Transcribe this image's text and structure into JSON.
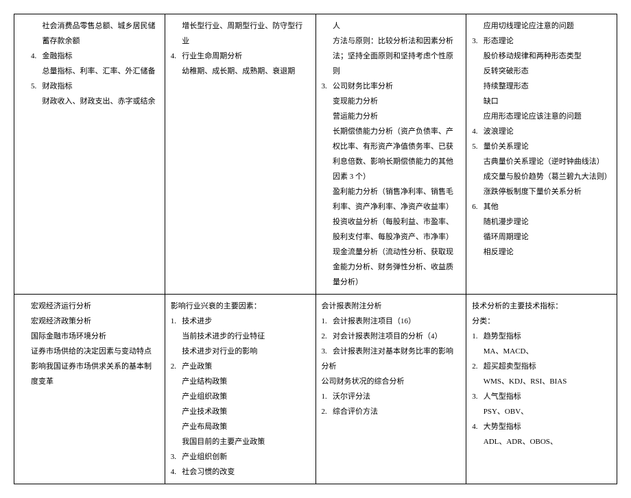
{
  "row1": {
    "c1": {
      "l1": "社会消费品零售总额、城乡居民储蓄存款余额",
      "n4": "4.",
      "t4": "金融指标",
      "t4a": "总量指标、利率、汇率、外汇储备",
      "n5": "5.",
      "t5": "财政指标",
      "t5a": "财政收入、财政支出、赤字或结余"
    },
    "c2": {
      "l1": "增长型行业、周期型行业、防守型行业",
      "n4": "4.",
      "t4": "行业生命周期分析",
      "t4a": "幼稚期、成长期、成熟期、衰退期"
    },
    "c3": {
      "l0": "人",
      "l1": "方法与原则：比较分析法和因素分析法；坚持全面原则和坚持考虑个性原则",
      "n3": "3.",
      "t3": "公司财务比率分析",
      "l3a": "变现能力分析",
      "l3b": "营运能力分析",
      "l3c": "长期偿债能力分析（资产负债率、产权比率、有形资产净值债务率、已获利息倍数、影响长期偿债能力的其他因素 3 个）",
      "l3d": "盈利能力分析（销售净利率、销售毛利率、资产净利率、净资产收益率）",
      "l3e": "投资收益分析（每股利益、市盈率、股利支付率、每股净资产、市净率）",
      "l3f": "现金流量分析（流动性分析、获取现金能力分析、财务弹性分析、收益质量分析）"
    },
    "c4": {
      "l1": "应用切线理论应注意的问题",
      "n3": "3.",
      "t3": "形态理论",
      "l3a": "股价移动规律和两种形态类型",
      "l3b": "反转突破形态",
      "l3c": "持续整理形态",
      "l3d": "缺口",
      "l3e": "应用形态理论应该注意的问题",
      "n4": "4.",
      "t4": "波浪理论",
      "n5": "5.",
      "t5": "量价关系理论",
      "l5a": "古典量价关系理论（逆时钟曲线法）",
      "l5b": "成交量与股价趋势（葛兰碧九大法则）",
      "l5c": "涨跌停板制度下量价关系分析",
      "n6": "6.",
      "t6": "其他",
      "l6a": "随机漫步理论",
      "l6b": "循环周期理论",
      "l6c": "相反理论"
    }
  },
  "row2": {
    "c1": {
      "l1": "宏观经济运行分析",
      "l2": "宏观经济政策分析",
      "l3": "国际金融市场环境分析",
      "l4": "证券市场供给的决定因素与变动特点",
      "l5": "影响我国证券市场供求关系的基本制度变革"
    },
    "c2": {
      "h": "影响行业兴衰的主要因素：",
      "n1": "1.",
      "t1": "技术进步",
      "l1a": "当前技术进步的行业特征",
      "l1b": "技术进步对行业的影响",
      "n2": "2.",
      "t2": "产业政策",
      "l2a": "产业结构政策",
      "l2b": "产业组织政策",
      "l2c": "产业技术政策",
      "l2d": "产业布局政策",
      "l2e": "我国目前的主要产业政策",
      "n3": "3.",
      "t3": "产业组织创新",
      "n4": "4.",
      "t4": "社会习惯的改变"
    },
    "c3": {
      "h": "会计报表附注分析",
      "n1": "1.",
      "t1": "会计报表附注项目（16）",
      "n2": "2.",
      "t2": "对会计报表附注项目的分析（4）",
      "n3": "3.",
      "t3": "会计报表附注对基本财务比率的影响分析",
      "h2": "公司财务状况的综合分析",
      "n4": "1.",
      "t4": "沃尔评分法",
      "n5": "2.",
      "t5": "综合评价方法"
    },
    "c4": {
      "h": "技术分析的主要技术指标：",
      "h2": "分类：",
      "n1": "1.",
      "t1": "趋势型指标",
      "l1a": "MA、MACD、",
      "n2": "2.",
      "t2": "超买超卖型指标",
      "l2a": "WMS、KDJ、RSI、BIAS",
      "n3": "3.",
      "t3": "人气型指标",
      "l3a": "PSY、OBV、",
      "n4": "4.",
      "t4": "大势型指标",
      "l4a": "ADL、ADR、OBOS、"
    }
  }
}
